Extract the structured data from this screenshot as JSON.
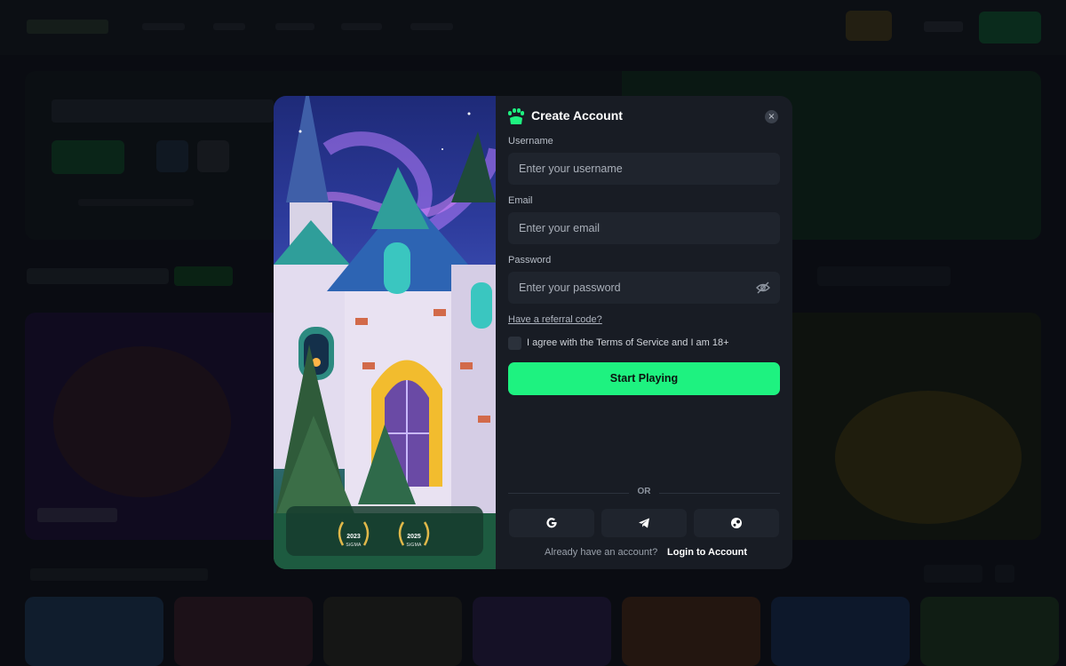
{
  "modal": {
    "title": "Create Account",
    "close_icon": "×",
    "username": {
      "label": "Username",
      "placeholder": "Enter your username"
    },
    "email": {
      "label": "Email",
      "placeholder": "Enter your email"
    },
    "password": {
      "label": "Password",
      "placeholder": "Enter your password",
      "toggle_icon": "eye-off-icon"
    },
    "referral_link": "Have a referral code?",
    "terms_text": "I agree with the Terms of Service and I am 18+",
    "submit_label": "Start Playing",
    "divider_label": "OR",
    "social_buttons": [
      {
        "name": "google-icon"
      },
      {
        "name": "telegram-icon"
      },
      {
        "name": "steam-icon"
      }
    ],
    "login_prompt": "Already have an account?",
    "login_link": "Login to Account",
    "awards": [
      {
        "year": "2023",
        "org": "SiGMA"
      },
      {
        "year": "2025",
        "org": "SiGMA"
      }
    ]
  },
  "colors": {
    "accent": "#1ef280",
    "panel": "#181c24",
    "input": "#1f242d"
  }
}
